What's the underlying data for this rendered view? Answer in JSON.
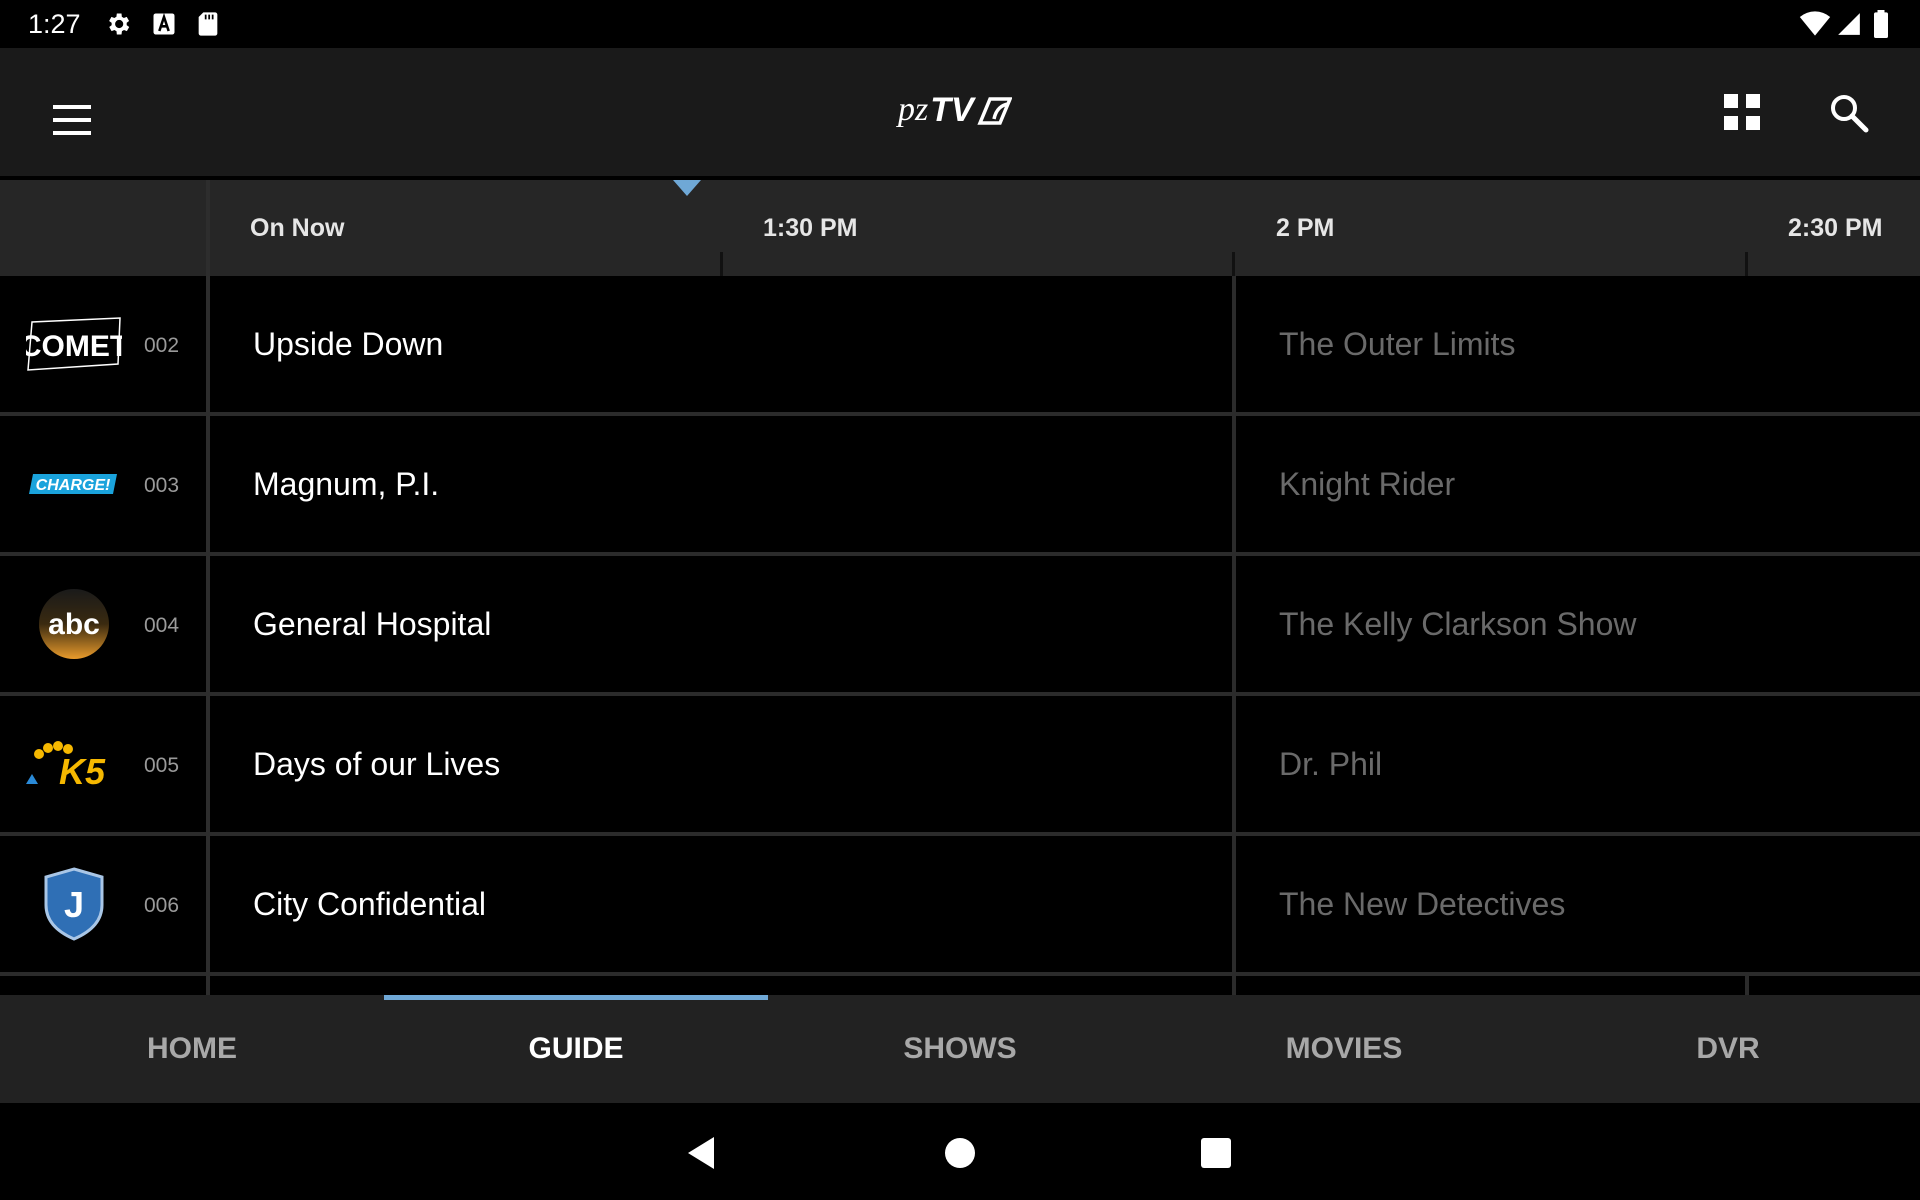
{
  "status_bar": {
    "time": "1:27",
    "left_icons": [
      "settings-icon",
      "a-icon",
      "sd-card-icon"
    ],
    "right_icons": [
      "wifi-icon",
      "signal-icon",
      "battery-icon"
    ]
  },
  "app_bar": {
    "logo_pz": "pz",
    "logo_tv": "TV",
    "menu_icon": "hamburger-menu-icon",
    "grid_icon": "grid-view-icon",
    "search_icon": "search-icon"
  },
  "guide": {
    "time_slots": [
      "On Now",
      "1:30 PM",
      "2 PM",
      "2:30 PM"
    ],
    "now_marker_color": "#6fa8d6",
    "channels": [
      {
        "number": "002",
        "logo": "comet-logo",
        "logo_text": "COMET",
        "now": "Upside Down",
        "next": "The Outer Limits"
      },
      {
        "number": "003",
        "logo": "charge-logo",
        "logo_text": "CHARGE!",
        "now": "Magnum, P.I.",
        "next": "Knight Rider"
      },
      {
        "number": "004",
        "logo": "abc-logo",
        "logo_text": "abc",
        "now": "General Hospital",
        "next": "The Kelly Clarkson Show"
      },
      {
        "number": "005",
        "logo": "k5-nbc-logo",
        "logo_text": "K5",
        "now": "Days of our Lives",
        "next": "Dr. Phil"
      },
      {
        "number": "006",
        "logo": "justice-logo",
        "logo_text": "J",
        "now": "City Confidential",
        "next": "The New Detectives"
      }
    ]
  },
  "tabs": [
    {
      "label": "HOME",
      "active": false
    },
    {
      "label": "GUIDE",
      "active": true
    },
    {
      "label": "SHOWS",
      "active": false
    },
    {
      "label": "MOVIES",
      "active": false
    },
    {
      "label": "DVR",
      "active": false
    }
  ],
  "nav_bar": {
    "back_icon": "back-triangle-icon",
    "home_icon": "home-circle-icon",
    "recents_icon": "recents-square-icon"
  },
  "colors": {
    "accent": "#6fa8d6",
    "app_bar_bg": "#1a1a1a",
    "tab_bar_bg": "#222222"
  }
}
